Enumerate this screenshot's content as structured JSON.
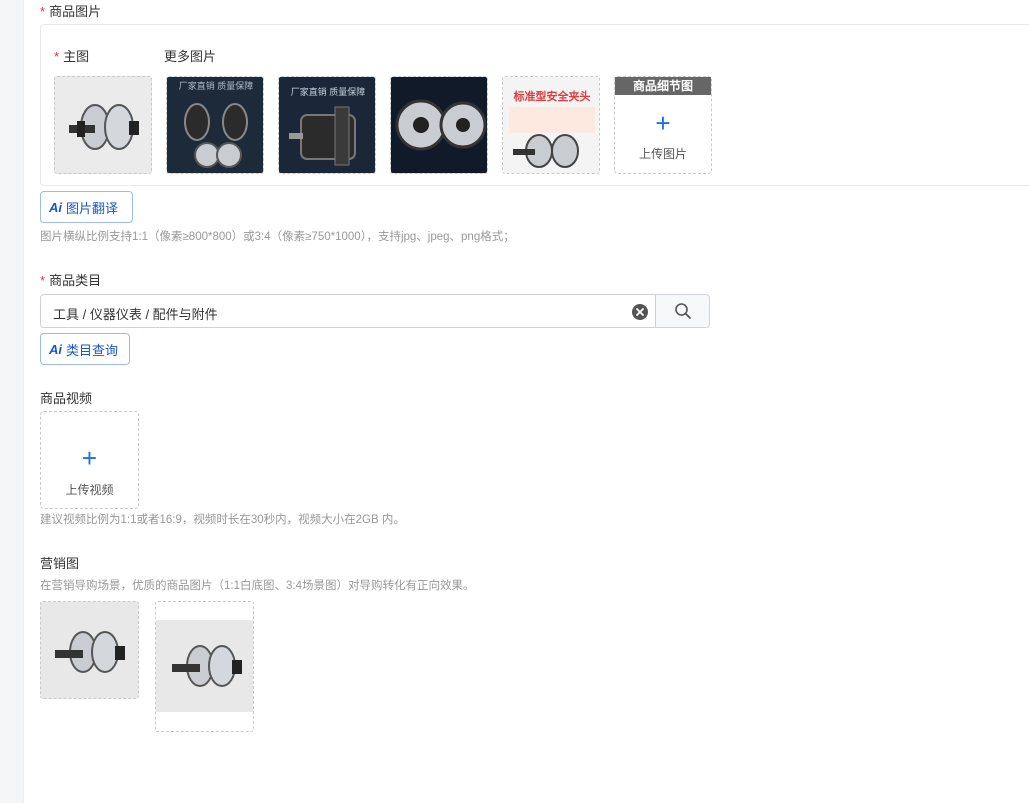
{
  "product_images": {
    "label": "商品图片",
    "main_label": "主图",
    "more_label": "更多图片",
    "thumbs": [
      {
        "name": "main-image",
        "overlay": ""
      },
      {
        "name": "more-image-1",
        "overlay": "厂家直销 质量保障"
      },
      {
        "name": "more-image-2",
        "overlay": "厂家直销 质量保障"
      },
      {
        "name": "more-image-3",
        "overlay": ""
      },
      {
        "name": "more-image-4",
        "overlay": "标准型安全夹头"
      }
    ],
    "detail_header": "商品细节图",
    "upload_label": "上传图片",
    "ai_button": "图片翻译",
    "hint": "图片横纵比例支持1:1（像素≥800*800）或3:4（像素≥750*1000），支持jpg、jpeg、png格式；"
  },
  "category": {
    "label": "商品类目",
    "value": "工具 / 仪器仪表 / 配件与附件",
    "ai_button": "类目查询"
  },
  "video": {
    "label": "商品视频",
    "upload_label": "上传视频",
    "hint": "建议视频比例为1:1或者16:9，视频时长在30秒内，视频大小在2GB 内。"
  },
  "marketing": {
    "label": "营销图",
    "hint": "在营销导购场景，优质的商品图片（1:1白底图、3:4场景图）对导购转化有正向效果。"
  },
  "ai_mark": "Ai",
  "colors": {
    "accent": "#1a73e8",
    "required": "#e4393c",
    "ai_blue": "#1a56c8"
  }
}
